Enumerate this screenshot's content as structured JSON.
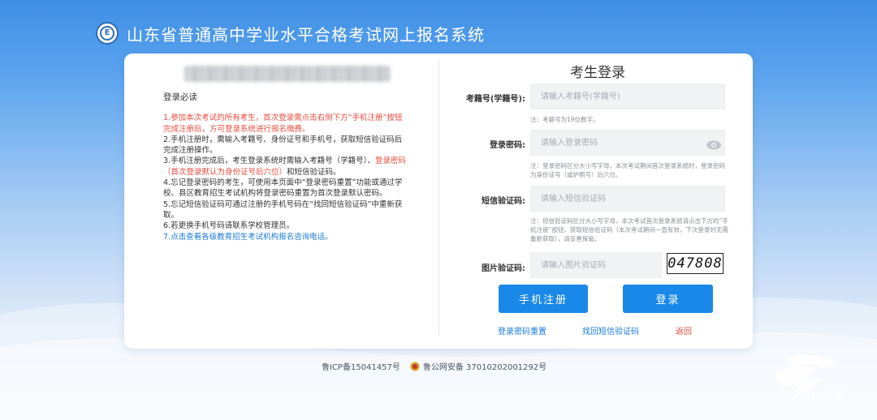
{
  "header": {
    "title": "山东省普通高中学业水平合格考试网上报名系统"
  },
  "notice": {
    "title": "登录必读",
    "items": {
      "i1": "1.参加本次考试的所有考生，首次登录需点击右侧下方“手机注册”按钮完成注册后，方可登录系统进行报名缴费。",
      "i2": "2.手机注册时，需输入考籍号、身份证号和手机号，获取短信验证码后完成注册操作。",
      "i3a": "3.手机注册完成后，考生登录系统时需输入考籍号（学籍号）、",
      "i3b": "登录密码（首次登录默认为身份证号后六位）",
      "i3c": "和短信验证码。",
      "i4": "4.忘记登录密码的考生，可使用本页面中“登录密码重置”功能或通过学校、县区教育招生考试机构将登录密码重置为首次登录默认密码。",
      "i5": "5.忘记短信验证码可通过注册的手机号码在“找回短信验证码”中重新获取。",
      "i6": "6.若更换手机号码请联系学校管理员。",
      "i7": "7.点击查看各级教育招生考试机构报名咨询电话。"
    }
  },
  "login": {
    "title": "考生登录",
    "exam_id": {
      "label": "考籍号(学籍号):",
      "placeholder": "请输入考籍号(学籍号)",
      "hint": "注：考籍号为19位数字。"
    },
    "password": {
      "label": "登录密码:",
      "placeholder": "请输入登录密码",
      "hint": "注：登录密码区分大小写字母，本次考试期间首次登录系统时，登录密码为身份证号（或护照号）后六位。"
    },
    "sms": {
      "label": "短信验证码:",
      "placeholder": "请输入短信验证码",
      "hint": "注：短信验证码区分大小写字母，本次考试首次登录系统请点击下方的“手机注册”按钮，获取短信验证码（本次考试期间一直有效，下次登录时无需重新获取），请妥善保管。"
    },
    "captcha": {
      "label": "图片验证码:",
      "placeholder": "请输入图片验证码",
      "code": "047808"
    },
    "register_button": "手机注册",
    "login_button": "登录",
    "links": {
      "reset_password": "登录密码重置",
      "recover_sms": "找回短信验证码",
      "back": "返回"
    }
  },
  "footer": {
    "icp": "鲁ICP备15041457号",
    "police": "鲁公网安备 37010202001292号"
  },
  "watermark": {
    "text": "闪电新闻"
  },
  "colors": {
    "primary": "#1a88e8",
    "warning": "#e84c3d",
    "link": "#1a7ad8"
  }
}
